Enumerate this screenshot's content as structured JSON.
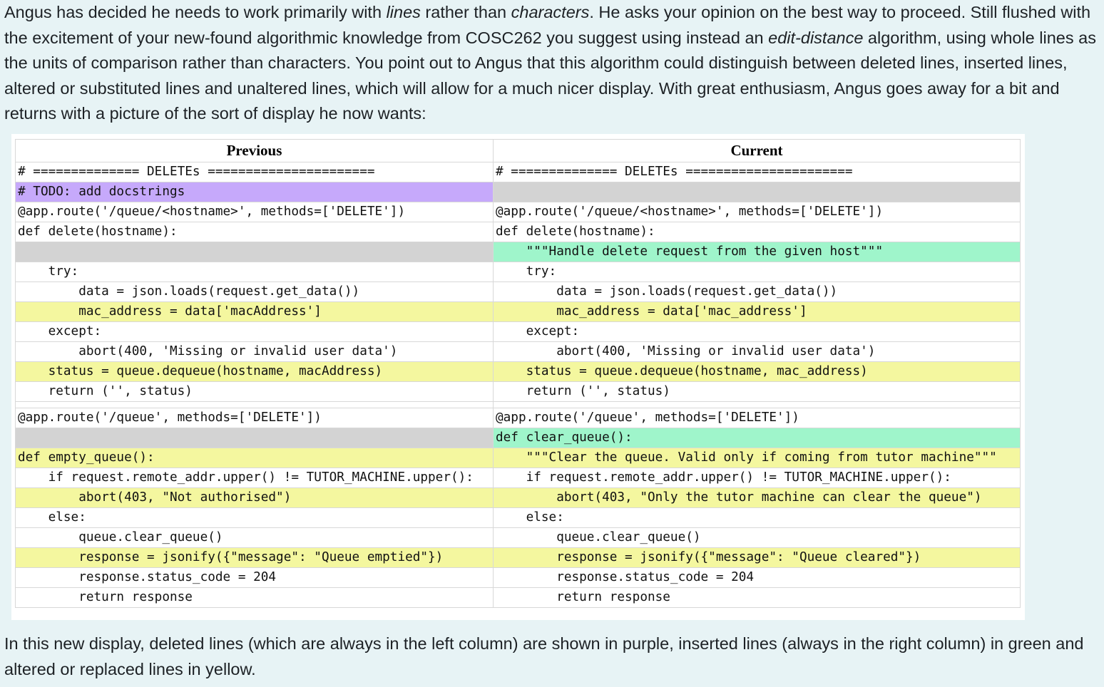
{
  "intro": {
    "p1": "Angus has decided he needs to work primarily with ",
    "em1": "lines",
    "p2": " rather than ",
    "em2": "characters",
    "p3": ". He asks your opinion on the best way to proceed. Still flushed with the excitement of your new-found algorithmic knowledge from COSC262 you suggest using instead an ",
    "em3": "edit-distance",
    "p4": " algorithm, using whole lines as the units of comparison rather than characters. You point out to Angus that this algorithm could distinguish between deleted lines, inserted lines, altered or substituted lines and unaltered lines, which will allow for a much nicer display. With great enthusiasm, Angus goes away for a bit and returns with a picture of the sort of display he now wants:"
  },
  "diff": {
    "header_left": "Previous",
    "header_right": "Current",
    "colors": {
      "deleted": "#c6a9fb",
      "inserted": "#9ff5cb",
      "changed": "#f4f79f",
      "blank": "#d3d3d3"
    },
    "rows": [
      {
        "kind": "same",
        "left": "# ============== DELETEs ======================",
        "right": "# ============== DELETEs ======================"
      },
      {
        "kind": "del",
        "left": "# TODO: add docstrings",
        "right": ""
      },
      {
        "kind": "same",
        "left": "@app.route('/queue/<hostname>', methods=['DELETE'])",
        "right": "@app.route('/queue/<hostname>', methods=['DELETE'])"
      },
      {
        "kind": "same",
        "left": "def delete(hostname):",
        "right": "def delete(hostname):"
      },
      {
        "kind": "ins",
        "left": "",
        "right": "    \"\"\"Handle delete request from the given host\"\"\""
      },
      {
        "kind": "same",
        "left": "    try:",
        "right": "    try:"
      },
      {
        "kind": "same",
        "left": "        data = json.loads(request.get_data())",
        "right": "        data = json.loads(request.get_data())"
      },
      {
        "kind": "chg",
        "left": "        mac_address = data['macAddress']",
        "right": "        mac_address = data['mac_address']"
      },
      {
        "kind": "same",
        "left": "    except:",
        "right": "    except:"
      },
      {
        "kind": "same",
        "left": "        abort(400, 'Missing or invalid user data')",
        "right": "        abort(400, 'Missing or invalid user data')"
      },
      {
        "kind": "chg",
        "left": "    status = queue.dequeue(hostname, macAddress)",
        "right": "    status = queue.dequeue(hostname, mac_address)"
      },
      {
        "kind": "same",
        "left": "    return ('', status)",
        "right": "    return ('', status)"
      },
      {
        "kind": "gap",
        "left": "",
        "right": ""
      },
      {
        "kind": "same",
        "left": "@app.route('/queue', methods=['DELETE'])",
        "right": "@app.route('/queue', methods=['DELETE'])"
      },
      {
        "kind": "ins",
        "left": "",
        "right": "def clear_queue():"
      },
      {
        "kind": "chg",
        "left": "def empty_queue():",
        "right": "    \"\"\"Clear the queue. Valid only if coming from tutor machine\"\"\""
      },
      {
        "kind": "same",
        "left": "    if request.remote_addr.upper() != TUTOR_MACHINE.upper():",
        "right": "    if request.remote_addr.upper() != TUTOR_MACHINE.upper():"
      },
      {
        "kind": "chg",
        "left": "        abort(403, \"Not authorised\")",
        "right": "        abort(403, \"Only the tutor machine can clear the queue\")"
      },
      {
        "kind": "same",
        "left": "    else:",
        "right": "    else:"
      },
      {
        "kind": "same",
        "left": "        queue.clear_queue()",
        "right": "        queue.clear_queue()"
      },
      {
        "kind": "chg",
        "left": "        response = jsonify({\"message\": \"Queue emptied\"})",
        "right": "        response = jsonify({\"message\": \"Queue cleared\"})"
      },
      {
        "kind": "same",
        "left": "        response.status_code = 204",
        "right": "        response.status_code = 204"
      },
      {
        "kind": "same",
        "left": "        return response",
        "right": "        return response"
      }
    ]
  },
  "outro": {
    "text": "In this new display, deleted lines (which are always in the left column) are shown in purple, inserted lines (always in the right column) in green and altered or replaced lines in yellow."
  }
}
